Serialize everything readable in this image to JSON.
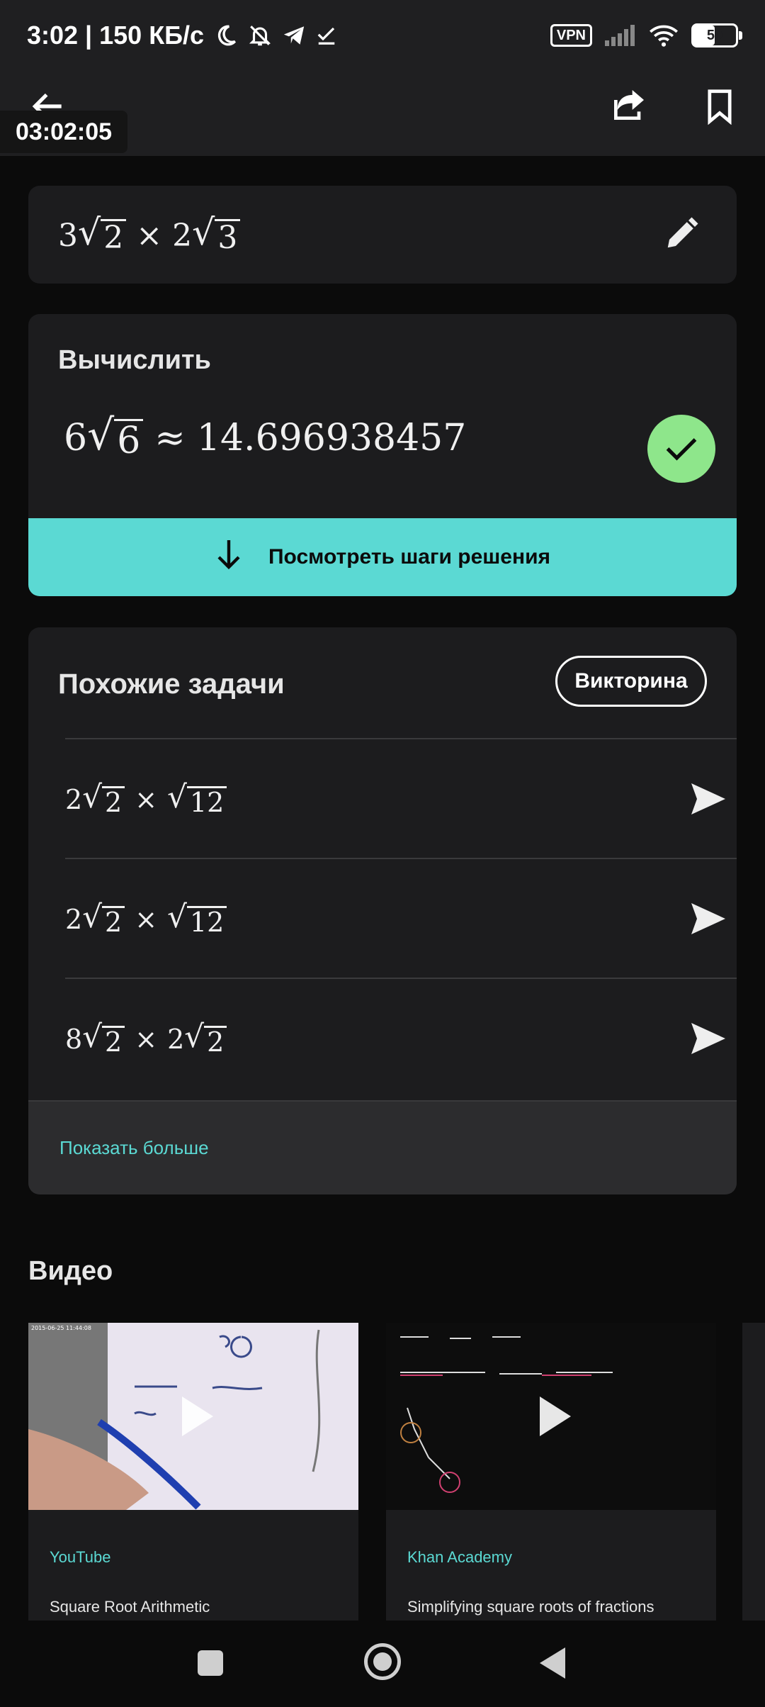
{
  "status_bar": {
    "time_speed": "3:02 | 150 КБ/с",
    "vpn": "VPN",
    "battery": "50",
    "battery_level": 0.5,
    "icons": [
      "moon-icon",
      "bell-off-icon",
      "telegram-icon",
      "check-download-icon",
      "signal-icon",
      "wifi-icon",
      "battery-icon"
    ]
  },
  "app_bar": {
    "timer": "03:02:05",
    "icons": [
      "back-arrow-icon",
      "share-icon",
      "bookmark-icon"
    ]
  },
  "problem": {
    "expression": {
      "a": "3",
      "r1": "2",
      "op": "×",
      "b": "2",
      "r2": "3"
    },
    "edit_icon": "pencil-icon"
  },
  "result": {
    "title": "Вычислить",
    "coef": "6",
    "radicand": "6",
    "approx": "≈",
    "decimal": "14.696938457",
    "steps_button": "Посмотреть шаги решения",
    "accent": "#5bd9d3",
    "check_color": "#8ee68b"
  },
  "similar": {
    "title": "Похожие задачи",
    "quiz_button": "Викторина",
    "problems": [
      {
        "a": "2",
        "r1": "2",
        "op": "×",
        "b": "",
        "r2": "12"
      },
      {
        "a": "2",
        "r1": "2",
        "op": "×",
        "b": "",
        "r2": "12"
      },
      {
        "a": "8",
        "r1": "2",
        "op": "×",
        "b": "2",
        "r2": "2"
      }
    ],
    "show_more": "Показать больше"
  },
  "videos": {
    "heading": "Видео",
    "items": [
      {
        "source": "YouTube",
        "title": "Square Root Arithmetic"
      },
      {
        "source": "Khan Academy",
        "title": "Simplifying square roots of fractions"
      }
    ]
  },
  "nav_bar": {
    "icons": [
      "recents-square-icon",
      "home-circle-icon",
      "back-triangle-icon"
    ]
  }
}
